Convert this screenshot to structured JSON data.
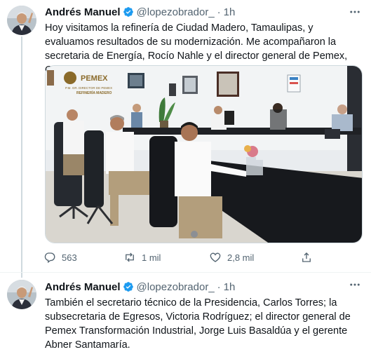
{
  "tweets": [
    {
      "author": "Andrés Manuel",
      "handle": "@lopezobrador_",
      "separator": "·",
      "time": "1h",
      "text": "Hoy visitamos la refinería de Ciudad Madero, Tamaulipas, y evaluamos resultados de su modernización. Me acompañaron la secretaria de Energía, Rocío Nahle y el director general de Pemex, Octavio Romero.",
      "media": {
        "sign_brand": "PEMEX",
        "sign_line1": "P.M. GR. DIRECTOR DE PEMEX",
        "sign_line2": "REFINERÍA MADERO"
      },
      "stats": {
        "replies": "563",
        "retweets": "1 mil",
        "likes": "2,8 mil"
      }
    },
    {
      "author": "Andrés Manuel",
      "handle": "@lopezobrador_",
      "separator": "·",
      "time": "1h",
      "text": "También el secretario técnico de la Presidencia, Carlos Torres; la subsecretaria de Egresos, Victoria Rodríguez; el director general de Pemex Transformación Industrial, Jorge Luis Basaldúa y el gerente Abner Santamaría."
    }
  ],
  "icons": {
    "verified": "verified-badge-icon",
    "more": "more-options-icon",
    "reply": "reply-icon",
    "retweet": "retweet-icon",
    "like": "heart-icon",
    "share": "share-icon"
  },
  "colors": {
    "verified": "#1d9bf0",
    "secondary_text": "#536471",
    "thread_line": "#cfd9de"
  }
}
